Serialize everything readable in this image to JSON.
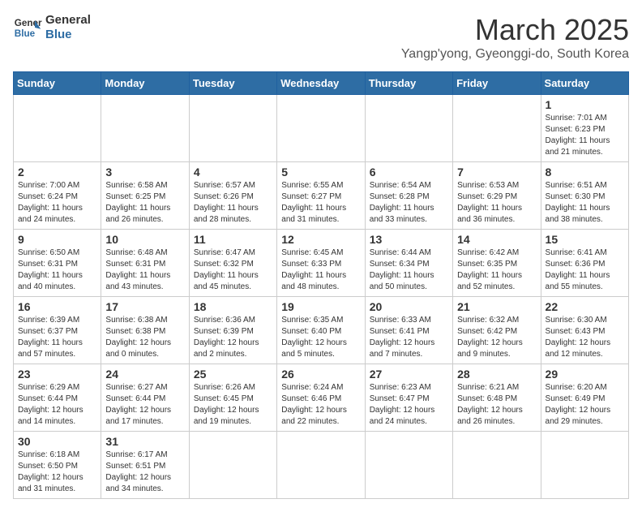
{
  "header": {
    "logo_general": "General",
    "logo_blue": "Blue",
    "month": "March 2025",
    "location": "Yangp'yong, Gyeonggi-do, South Korea"
  },
  "days_of_week": [
    "Sunday",
    "Monday",
    "Tuesday",
    "Wednesday",
    "Thursday",
    "Friday",
    "Saturday"
  ],
  "weeks": [
    [
      {
        "day": "",
        "info": ""
      },
      {
        "day": "",
        "info": ""
      },
      {
        "day": "",
        "info": ""
      },
      {
        "day": "",
        "info": ""
      },
      {
        "day": "",
        "info": ""
      },
      {
        "day": "",
        "info": ""
      },
      {
        "day": "1",
        "info": "Sunrise: 7:01 AM\nSunset: 6:23 PM\nDaylight: 11 hours and 21 minutes."
      }
    ],
    [
      {
        "day": "2",
        "info": "Sunrise: 7:00 AM\nSunset: 6:24 PM\nDaylight: 11 hours and 24 minutes."
      },
      {
        "day": "3",
        "info": "Sunrise: 6:58 AM\nSunset: 6:25 PM\nDaylight: 11 hours and 26 minutes."
      },
      {
        "day": "4",
        "info": "Sunrise: 6:57 AM\nSunset: 6:26 PM\nDaylight: 11 hours and 28 minutes."
      },
      {
        "day": "5",
        "info": "Sunrise: 6:55 AM\nSunset: 6:27 PM\nDaylight: 11 hours and 31 minutes."
      },
      {
        "day": "6",
        "info": "Sunrise: 6:54 AM\nSunset: 6:28 PM\nDaylight: 11 hours and 33 minutes."
      },
      {
        "day": "7",
        "info": "Sunrise: 6:53 AM\nSunset: 6:29 PM\nDaylight: 11 hours and 36 minutes."
      },
      {
        "day": "8",
        "info": "Sunrise: 6:51 AM\nSunset: 6:30 PM\nDaylight: 11 hours and 38 minutes."
      }
    ],
    [
      {
        "day": "9",
        "info": "Sunrise: 6:50 AM\nSunset: 6:31 PM\nDaylight: 11 hours and 40 minutes."
      },
      {
        "day": "10",
        "info": "Sunrise: 6:48 AM\nSunset: 6:31 PM\nDaylight: 11 hours and 43 minutes."
      },
      {
        "day": "11",
        "info": "Sunrise: 6:47 AM\nSunset: 6:32 PM\nDaylight: 11 hours and 45 minutes."
      },
      {
        "day": "12",
        "info": "Sunrise: 6:45 AM\nSunset: 6:33 PM\nDaylight: 11 hours and 48 minutes."
      },
      {
        "day": "13",
        "info": "Sunrise: 6:44 AM\nSunset: 6:34 PM\nDaylight: 11 hours and 50 minutes."
      },
      {
        "day": "14",
        "info": "Sunrise: 6:42 AM\nSunset: 6:35 PM\nDaylight: 11 hours and 52 minutes."
      },
      {
        "day": "15",
        "info": "Sunrise: 6:41 AM\nSunset: 6:36 PM\nDaylight: 11 hours and 55 minutes."
      }
    ],
    [
      {
        "day": "16",
        "info": "Sunrise: 6:39 AM\nSunset: 6:37 PM\nDaylight: 11 hours and 57 minutes."
      },
      {
        "day": "17",
        "info": "Sunrise: 6:38 AM\nSunset: 6:38 PM\nDaylight: 12 hours and 0 minutes."
      },
      {
        "day": "18",
        "info": "Sunrise: 6:36 AM\nSunset: 6:39 PM\nDaylight: 12 hours and 2 minutes."
      },
      {
        "day": "19",
        "info": "Sunrise: 6:35 AM\nSunset: 6:40 PM\nDaylight: 12 hours and 5 minutes."
      },
      {
        "day": "20",
        "info": "Sunrise: 6:33 AM\nSunset: 6:41 PM\nDaylight: 12 hours and 7 minutes."
      },
      {
        "day": "21",
        "info": "Sunrise: 6:32 AM\nSunset: 6:42 PM\nDaylight: 12 hours and 9 minutes."
      },
      {
        "day": "22",
        "info": "Sunrise: 6:30 AM\nSunset: 6:43 PM\nDaylight: 12 hours and 12 minutes."
      }
    ],
    [
      {
        "day": "23",
        "info": "Sunrise: 6:29 AM\nSunset: 6:44 PM\nDaylight: 12 hours and 14 minutes."
      },
      {
        "day": "24",
        "info": "Sunrise: 6:27 AM\nSunset: 6:44 PM\nDaylight: 12 hours and 17 minutes."
      },
      {
        "day": "25",
        "info": "Sunrise: 6:26 AM\nSunset: 6:45 PM\nDaylight: 12 hours and 19 minutes."
      },
      {
        "day": "26",
        "info": "Sunrise: 6:24 AM\nSunset: 6:46 PM\nDaylight: 12 hours and 22 minutes."
      },
      {
        "day": "27",
        "info": "Sunrise: 6:23 AM\nSunset: 6:47 PM\nDaylight: 12 hours and 24 minutes."
      },
      {
        "day": "28",
        "info": "Sunrise: 6:21 AM\nSunset: 6:48 PM\nDaylight: 12 hours and 26 minutes."
      },
      {
        "day": "29",
        "info": "Sunrise: 6:20 AM\nSunset: 6:49 PM\nDaylight: 12 hours and 29 minutes."
      }
    ],
    [
      {
        "day": "30",
        "info": "Sunrise: 6:18 AM\nSunset: 6:50 PM\nDaylight: 12 hours and 31 minutes."
      },
      {
        "day": "31",
        "info": "Sunrise: 6:17 AM\nSunset: 6:51 PM\nDaylight: 12 hours and 34 minutes."
      },
      {
        "day": "",
        "info": ""
      },
      {
        "day": "",
        "info": ""
      },
      {
        "day": "",
        "info": ""
      },
      {
        "day": "",
        "info": ""
      },
      {
        "day": "",
        "info": ""
      }
    ]
  ]
}
